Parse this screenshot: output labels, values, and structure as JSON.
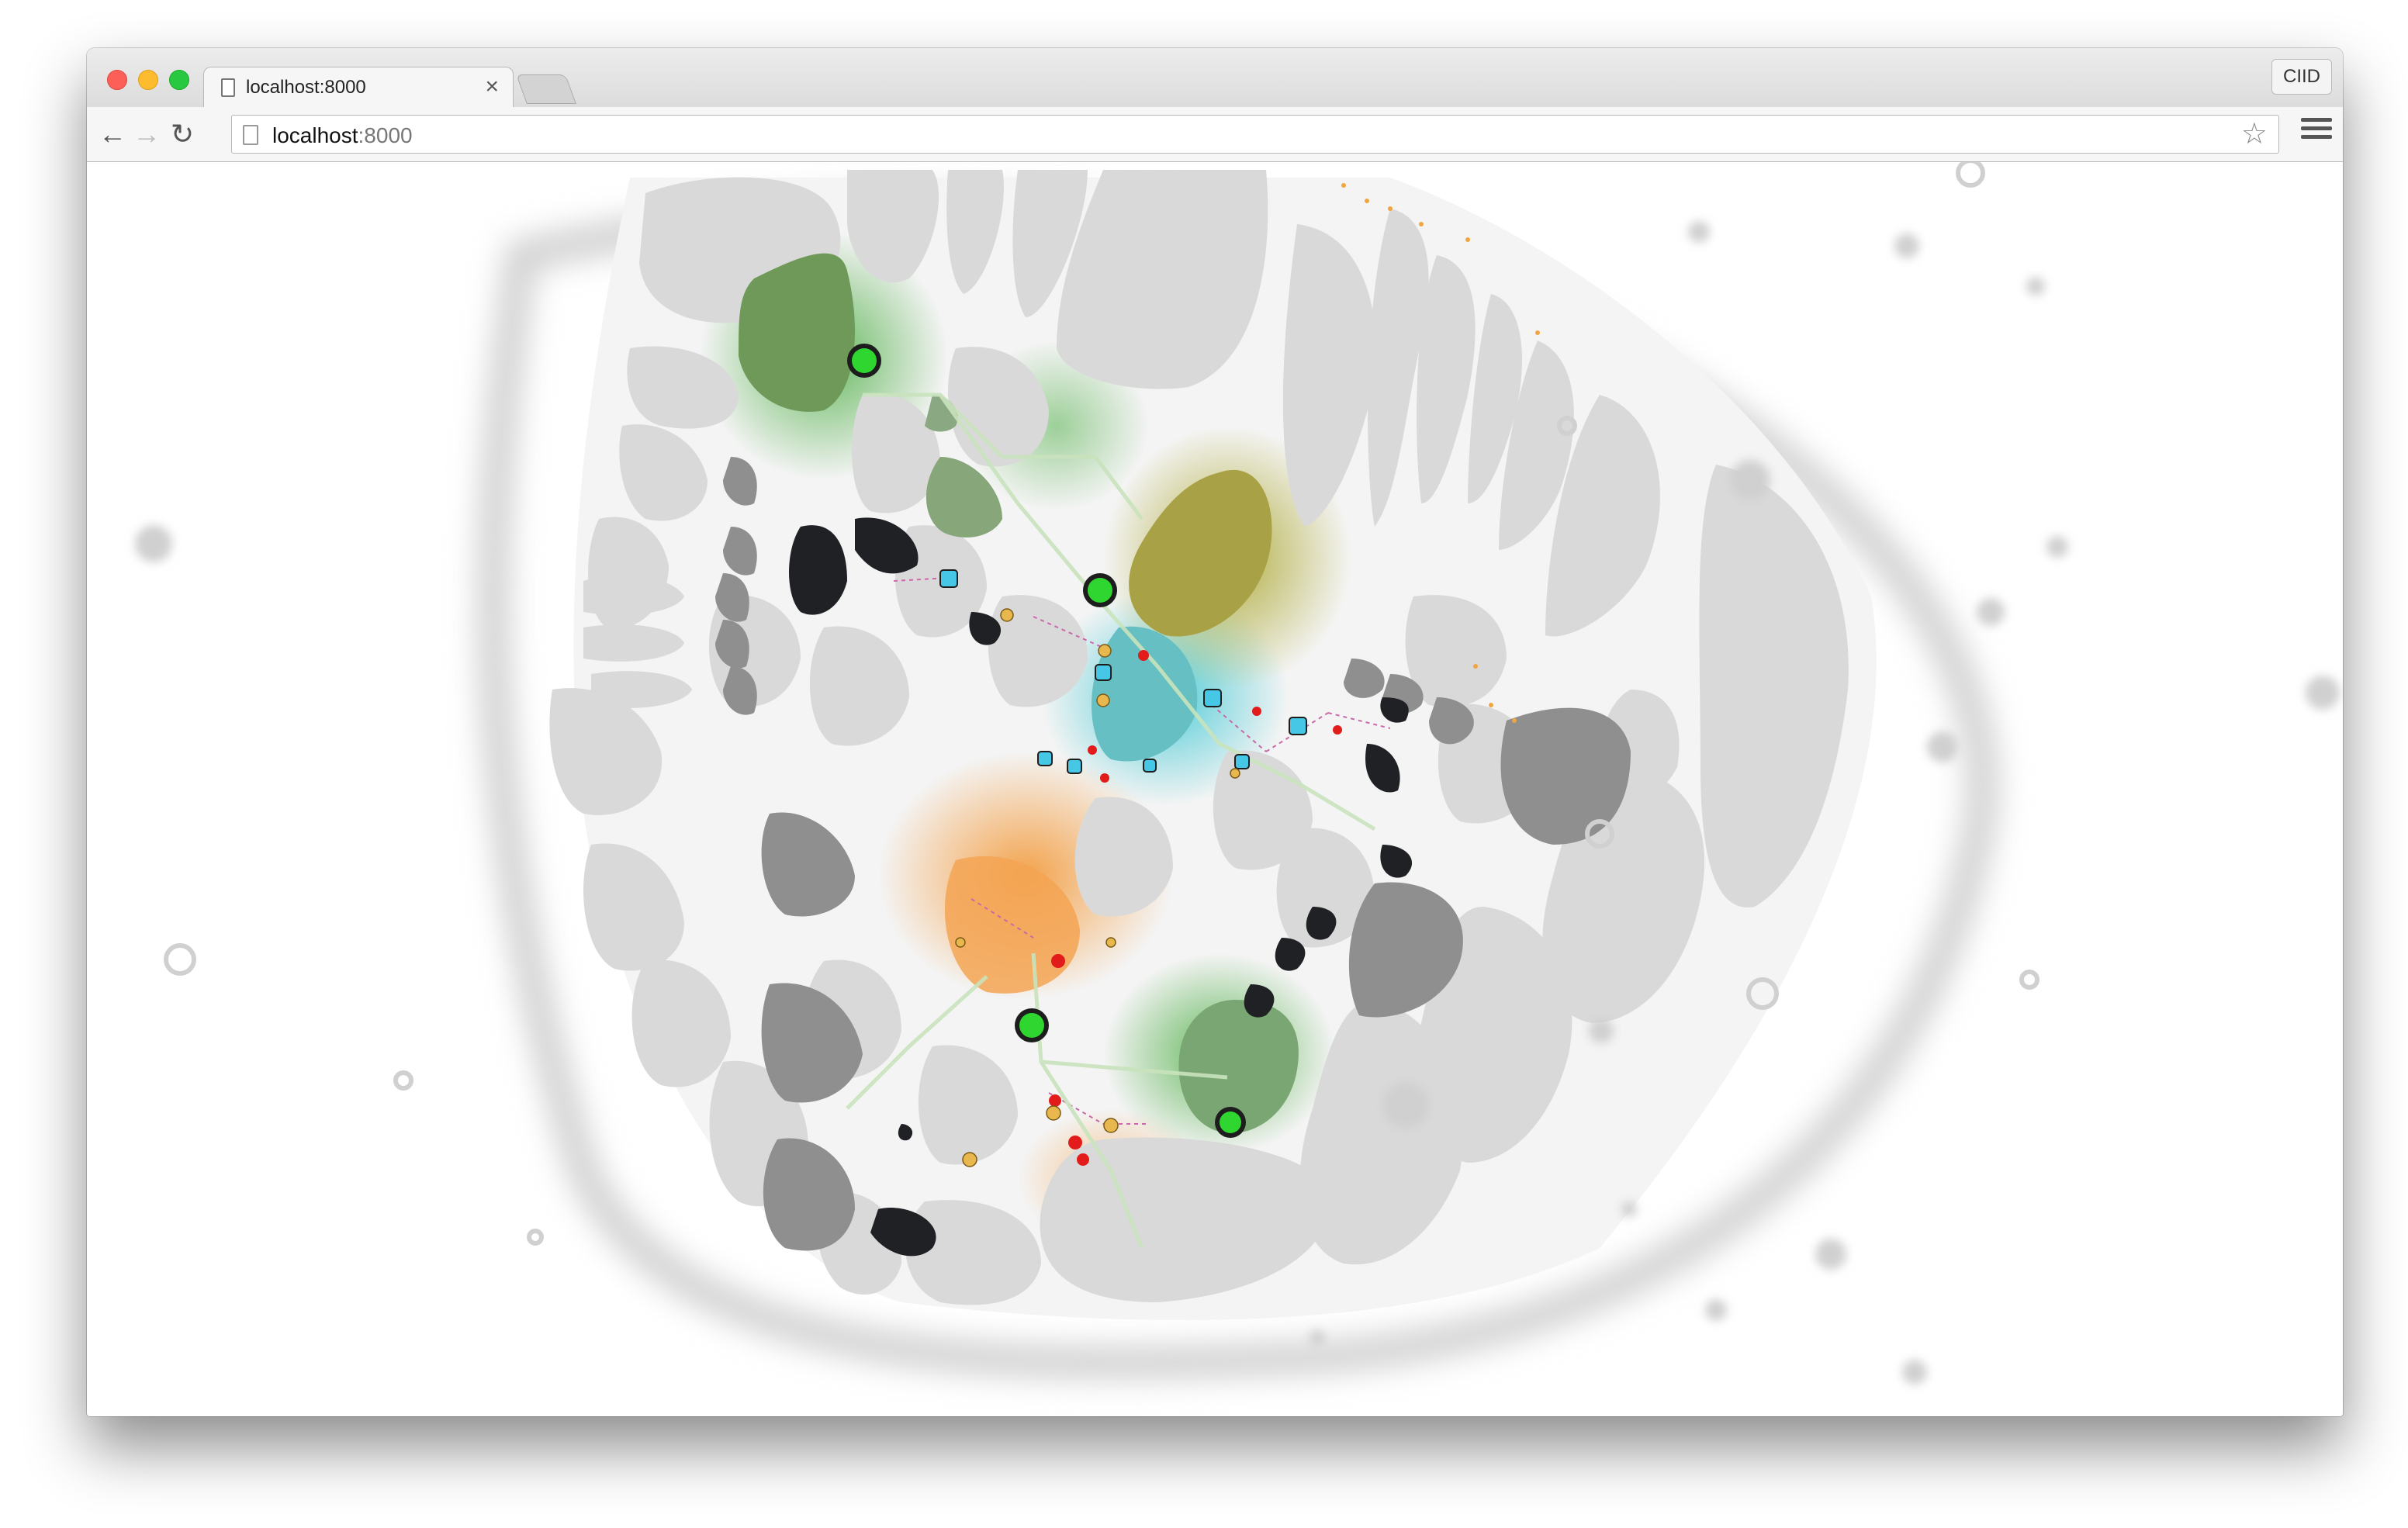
{
  "browser": {
    "tab": {
      "title": "localhost:8000",
      "close_glyph": "×"
    },
    "profile_label": "CIID",
    "address_bar": {
      "host": "localhost",
      "port": ":8000"
    },
    "icons": {
      "back": "back-arrow-icon",
      "forward": "forward-arrow-icon",
      "reload": "reload-icon",
      "bookmark": "star-icon",
      "menu": "hamburger-menu-icon",
      "page": "document-icon"
    }
  },
  "visualization": {
    "description_tag": "cell-network-simulation",
    "colors": {
      "cell_gray": "#d8d8d8",
      "cell_dark": "#8e8e8e",
      "cell_black": "#1c1c1c",
      "green_node": "#2fd62f",
      "cyan_node": "#46c7e6",
      "red_node": "#e62020",
      "orange_glow": "#f5a04a",
      "teal_glow": "#4fc9d4",
      "olive_glow": "#b7b030",
      "green_glow": "#6fbd4a"
    }
  }
}
